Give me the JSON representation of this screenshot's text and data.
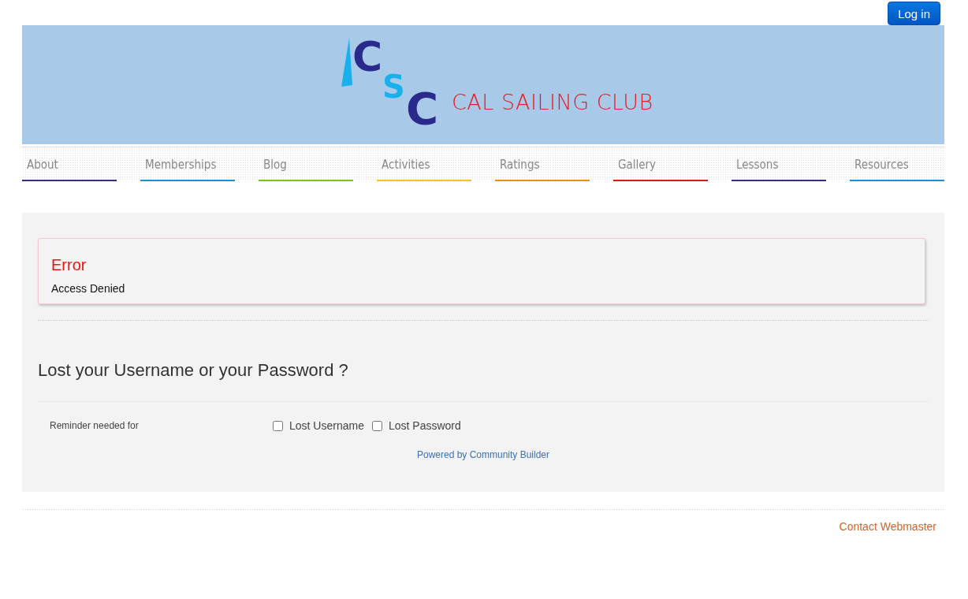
{
  "header": {
    "login_button": "Log in"
  },
  "logo": {
    "letters": [
      "C",
      "S",
      "C"
    ],
    "name": "CAL SAILING CLUB"
  },
  "nav": [
    {
      "label": "About",
      "color": "#3a2a8c"
    },
    {
      "label": "Memberships",
      "color": "#1a8fdc"
    },
    {
      "label": "Blog",
      "color": "#7cc11e"
    },
    {
      "label": "Activities",
      "color": "#f5c518"
    },
    {
      "label": "Ratings",
      "color": "#f08a10"
    },
    {
      "label": "Gallery",
      "color": "#e8141c"
    },
    {
      "label": "Lessons",
      "color": "#3a2a8c"
    },
    {
      "label": "Resources",
      "color": "#1a8fdc"
    }
  ],
  "error": {
    "title": "Error",
    "message": "Access Denied"
  },
  "form": {
    "heading": "Lost your Username or your Password ?",
    "field_label": "Reminder needed for",
    "options": [
      {
        "label": "Lost Username",
        "checked": false
      },
      {
        "label": "Lost Password",
        "checked": false
      }
    ],
    "powered_by": "Powered by Community Builder"
  },
  "footer": {
    "link": "Contact Webmaster"
  }
}
